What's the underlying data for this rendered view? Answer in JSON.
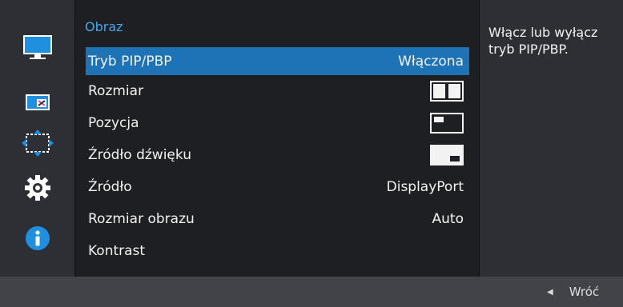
{
  "menu": {
    "title": "Obraz",
    "items": [
      {
        "label": "Tryb PIP/PBP",
        "value": "Włączona",
        "selected": true
      },
      {
        "label": "Rozmiar",
        "value_icon": "pbp-side-by-side-icon"
      },
      {
        "label": "Pozycja",
        "value_icon": "pip-top-left-icon"
      },
      {
        "label": "Źródło dźwięku",
        "value_icon": "pip-sound-source-icon"
      },
      {
        "label": "Źródło",
        "value": "DisplayPort"
      },
      {
        "label": "Rozmiar obrazu",
        "value": "Auto"
      },
      {
        "label": "Kontrast"
      }
    ]
  },
  "sidebar": {
    "icons": [
      "picture-monitor-icon",
      "pip-pbp-icon",
      "onscreen-display-icon",
      "system-gear-icon",
      "information-icon"
    ]
  },
  "help": {
    "text": "Włącz lub wyłącz tryb PIP/PBP."
  },
  "bottom": {
    "back_label": "Wróć",
    "back_icon": "left-arrow-icon"
  },
  "colors": {
    "accent": "#1e73b6",
    "title": "#4aa6ec",
    "panel": "#1e1f23",
    "side": "#2d2f34",
    "bar": "#414349"
  }
}
